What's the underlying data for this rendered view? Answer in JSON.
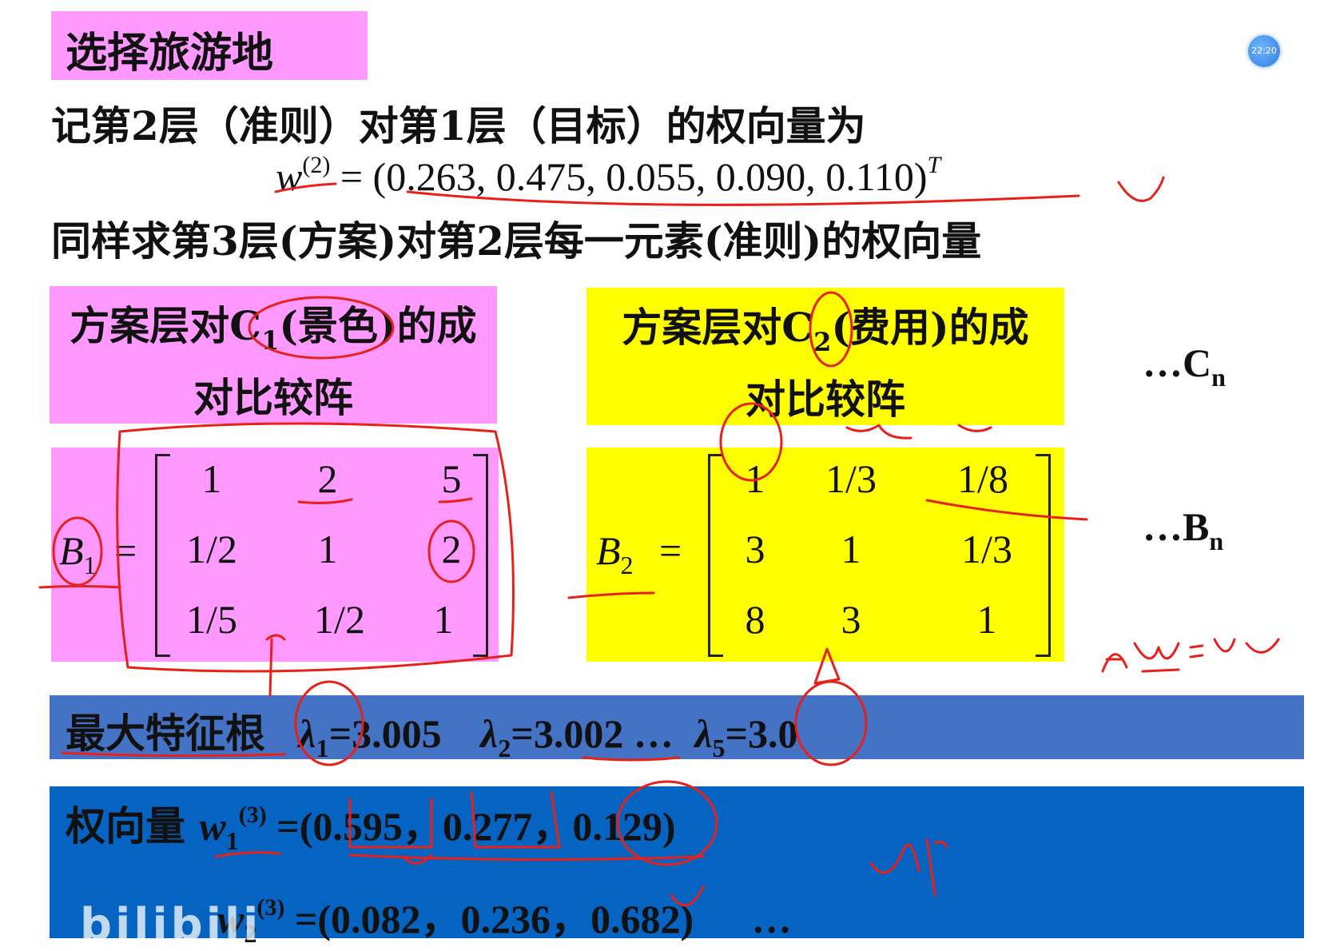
{
  "slide": {
    "title": "选择旅游地",
    "line1": "记第2层（准则）对第1层（目标）的权向量为",
    "w2_formula": {
      "lhs_var": "w",
      "lhs_sup": "(2)",
      "eq": " = ",
      "vector": "(0.263, 0.475, 0.055, 0.090, 0.110)",
      "transpose": "T"
    },
    "line2": "同样求第3层(方案)对第2层每一元素(准则)的权向量",
    "left_box": {
      "header_part1": "方案层对C",
      "header_sub": "1",
      "header_part2": "(景色)的成",
      "header_line2": "对比较阵",
      "matrix_name": "B",
      "matrix_sub": "1",
      "eq": "=",
      "rows": [
        [
          "1",
          "2",
          "5"
        ],
        [
          "1/2",
          "1",
          "2"
        ],
        [
          "1/5",
          "1/2",
          "1"
        ]
      ]
    },
    "right_box": {
      "header_part1": "方案层对C",
      "header_sub": "2",
      "header_part2": "(费用)的成",
      "header_line2": "对比较阵",
      "matrix_name": "B",
      "matrix_sub": "2",
      "eq": "=",
      "rows": [
        [
          "1",
          "1/3",
          "1/8"
        ],
        [
          "3",
          "1",
          "1/3"
        ],
        [
          "8",
          "3",
          "1"
        ]
      ]
    },
    "cn_label": "…C",
    "cn_sub": "n",
    "bn_label": "…B",
    "bn_sub": "n",
    "eigen_bar": {
      "label": "最大特征根",
      "l1_sym": "λ",
      "l1_sub": "1",
      "l1_val": "=3.005",
      "l2_sym": "λ",
      "l2_sub": "2",
      "l2_val": "=3.002 …",
      "l5_sym": "λ",
      "l5_sub": "5",
      "l5_val": "=3.0"
    },
    "weight_bar": {
      "label": "权向量",
      "w1_var": "w",
      "w1_sub": "1",
      "w1_sup": "(3)",
      "w1_val": " =(0.595，0.277，0.129)",
      "w2_var": "w",
      "w2_sub": "2",
      "w2_sup": "(3)",
      "w2_val": " =(0.082，0.236，0.682)",
      "ellipsis": "…"
    }
  },
  "overlay": {
    "clock_text": "22:20",
    "watermark": "bilibili"
  },
  "colors": {
    "magenta": "#ff99ff",
    "yellow": "#ffff00",
    "blue_bar1": "#4472c4",
    "blue_bar2": "#0563c1",
    "ink_red": "#e8201a"
  }
}
